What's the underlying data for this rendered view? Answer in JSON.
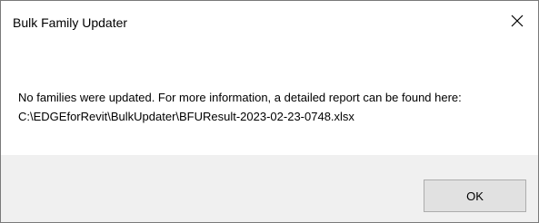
{
  "window": {
    "title": "Bulk Family Updater",
    "close_icon": "close-icon"
  },
  "message": {
    "text": "No families were updated. For more information, a detailed report can be found here: C:\\EDGEforRevit\\BulkUpdater\\BFUResult-2023-02-23-0748.xlsx"
  },
  "buttons": {
    "ok_label": "OK"
  },
  "colors": {
    "footer_background": "#f0f0f0",
    "button_background": "#e1e1e1",
    "button_border": "#adadad"
  }
}
